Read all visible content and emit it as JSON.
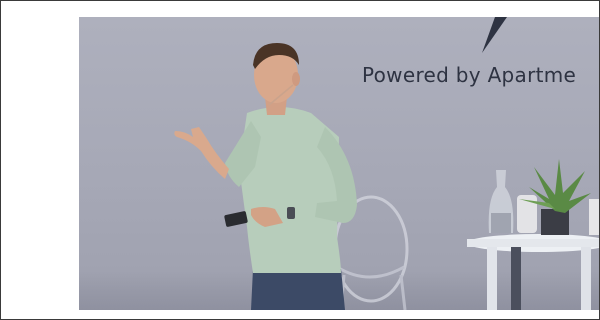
{
  "photo": {
    "stage_caption": "Powered by Apartme"
  },
  "colors": {
    "wall": "#a9abb8",
    "caption": "#2e3342",
    "shirt": "#b7cdbb",
    "jeans": "#3c4a66",
    "table": "#e8ebf0"
  }
}
